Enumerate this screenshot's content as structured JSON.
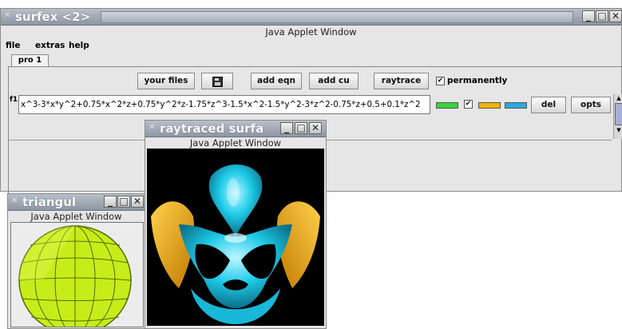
{
  "main_window": {
    "title": "surfex <2>",
    "applet_caption": "Java Applet Window",
    "menu": [
      "file",
      "extras",
      "help"
    ],
    "tab": "pro 1",
    "toolbar": {
      "your_files": "your files",
      "add_eqn": "add eqn",
      "add_cu": "add cu",
      "raytrace": "raytrace",
      "permanently": "permanently"
    },
    "equation": {
      "label": "f1",
      "value": "x^3-3*x*y^2+0.75*x^2*z+0.75*y^2*z-1.75*z^3-1.5*x^2-1.5*y^2-3*z^2-0.75*z+0.5+0.1*z^2",
      "del": "del",
      "opts": "opts"
    },
    "colors": {
      "swatch1": "#35d435",
      "swatch2": "#f0b400",
      "swatch3": "#2aa9e0"
    }
  },
  "raytraced_window": {
    "title": "raytraced surfa",
    "applet_caption": "Java Applet Window",
    "colors": {
      "surface_cyan": "#1ecbe8",
      "surface_orange": "#f2a60a"
    }
  },
  "triangul_window": {
    "title": "triangul",
    "applet_caption": "Java Applet Window",
    "colors": {
      "sphere": "#c8ec1a"
    }
  }
}
